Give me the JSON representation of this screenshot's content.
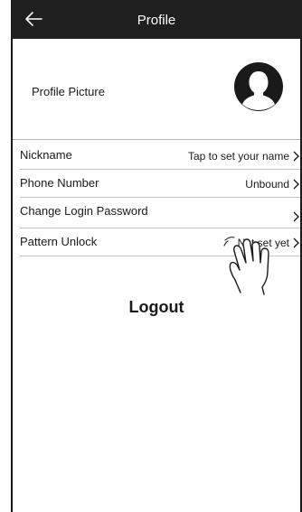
{
  "header": {
    "title": "Profile",
    "back_icon": "back-arrow-icon"
  },
  "profile": {
    "label": "Profile Picture",
    "avatar_icon": "user-silhouette-icon"
  },
  "rows": [
    {
      "label": "Nickname",
      "value": "Tap to set your name"
    },
    {
      "label": "Phone Number",
      "value": "Unbound"
    },
    {
      "label": "Change Login Password",
      "value": ""
    },
    {
      "label": "Pattern Unlock",
      "value": "Not set yet"
    }
  ],
  "logout_label": "Logout",
  "overlay": {
    "hand_icon": "tapping-hand-icon"
  },
  "colors": {
    "header_bg": "#1f1f1f",
    "header_text": "#ffffff",
    "divider": "#c4c4c4",
    "text": "#1a1a1a"
  }
}
